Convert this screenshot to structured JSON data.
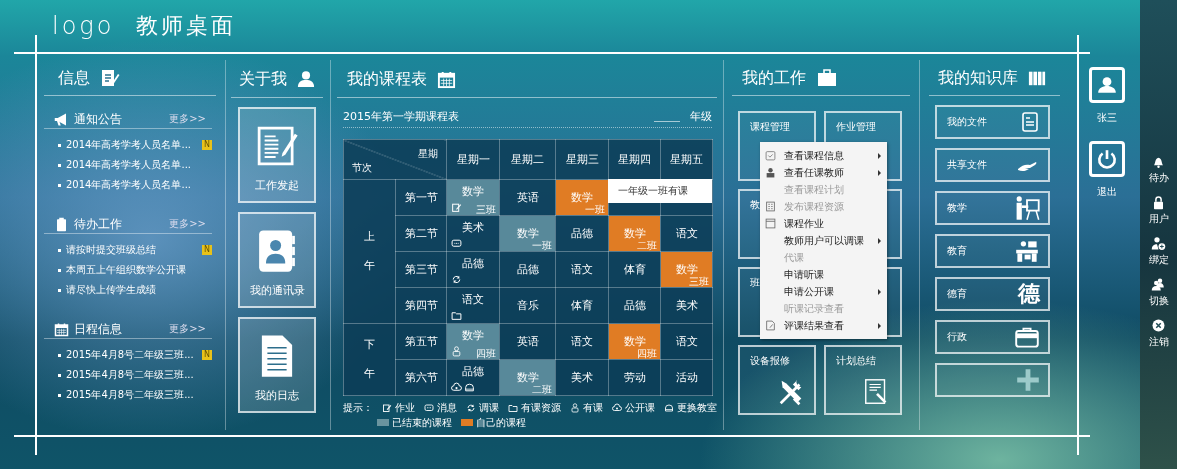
{
  "header": {
    "logo": "logo",
    "title": "教师桌面"
  },
  "info": {
    "title": "信息",
    "sections": [
      {
        "title": "通知公告",
        "more": "更多>>",
        "items": [
          {
            "text": "2014年高考学考人员名单...",
            "badge": "N"
          },
          {
            "text": "2014年高考学考人员名单..."
          },
          {
            "text": "2014年高考学考人员名单..."
          }
        ]
      },
      {
        "title": "待办工作",
        "more": "更多>>",
        "items": [
          {
            "text": "请按时提交班级总结",
            "badge": "N"
          },
          {
            "text": "本周五上午组织数学公开课"
          },
          {
            "text": "请尽快上传学生成绩"
          }
        ]
      },
      {
        "title": "日程信息",
        "more": "更多>>",
        "items": [
          {
            "text": "2015年4月8号二年级三班...",
            "badge": "N"
          },
          {
            "text": "2015年4月8号二年级三班..."
          },
          {
            "text": "2015年4月8号二年级三班..."
          }
        ]
      }
    ]
  },
  "about": {
    "title": "关于我",
    "tiles": [
      {
        "label": "工作发起"
      },
      {
        "label": "我的通讯录"
      },
      {
        "label": "我的日志"
      }
    ]
  },
  "schedule": {
    "title": "我的课程表",
    "term": "2015年第一学期课程表",
    "grade_label": "年级",
    "corner_top": "星期",
    "corner_bottom": "节次",
    "days": [
      "星期一",
      "星期二",
      "星期三",
      "星期四",
      "星期五"
    ],
    "blocks": [
      {
        "label": "上午",
        "rows": [
          {
            "period": "第一节",
            "cells": [
              {
                "subject": "数学",
                "class": "三班",
                "kind": "ended",
                "icons": [
                  {
                    "kind": "homework"
                  }
                ]
              },
              {
                "subject": "英语",
                "kind": "normal"
              },
              {
                "subject": "数学",
                "class": "一班",
                "kind": "own"
              },
              {
                "kind": "normal"
              },
              {
                "kind": "normal"
              }
            ]
          },
          {
            "period": "第二节",
            "cells": [
              {
                "subject": "美术",
                "kind": "normal",
                "icons": [
                  {
                    "kind": "message"
                  }
                ]
              },
              {
                "subject": "数学",
                "class": "一班",
                "kind": "ended"
              },
              {
                "subject": "品德",
                "kind": "normal"
              },
              {
                "subject": "数学",
                "class": "二班",
                "kind": "own"
              },
              {
                "subject": "语文",
                "kind": "normal"
              }
            ]
          },
          {
            "period": "第三节",
            "cells": [
              {
                "subject": "品德",
                "kind": "normal",
                "icons": [
                  {
                    "kind": "swap"
                  }
                ]
              },
              {
                "subject": "品德",
                "kind": "normal"
              },
              {
                "subject": "语文",
                "kind": "normal"
              },
              {
                "subject": "体育",
                "kind": "normal"
              },
              {
                "subject": "数学",
                "class": "三班",
                "kind": "own"
              }
            ]
          },
          {
            "period": "第四节",
            "cells": [
              {
                "subject": "语文",
                "kind": "normal",
                "icons": [
                  {
                    "kind": "resource"
                  }
                ]
              },
              {
                "subject": "音乐",
                "kind": "normal"
              },
              {
                "subject": "体育",
                "kind": "normal"
              },
              {
                "subject": "品德",
                "kind": "normal"
              },
              {
                "subject": "美术",
                "kind": "normal"
              }
            ]
          }
        ]
      },
      {
        "label": "下午",
        "rows": [
          {
            "period": "第五节",
            "cells": [
              {
                "subject": "数学",
                "class": "四班",
                "kind": "ended",
                "icons": [
                  {
                    "kind": "lesson"
                  }
                ]
              },
              {
                "subject": "英语",
                "kind": "normal"
              },
              {
                "subject": "语文",
                "kind": "normal"
              },
              {
                "subject": "数学",
                "class": "四班",
                "kind": "own"
              },
              {
                "subject": "语文",
                "kind": "normal"
              }
            ]
          },
          {
            "period": "第六节",
            "cells": [
              {
                "subject": "品德",
                "kind": "normal",
                "icons": [
                  {
                    "kind": "open"
                  },
                  {
                    "kind": "room"
                  }
                ]
              },
              {
                "subject": "数学",
                "class": "二班",
                "kind": "ended"
              },
              {
                "subject": "美术",
                "kind": "normal"
              },
              {
                "subject": "劳动",
                "kind": "normal"
              },
              {
                "subject": "活动",
                "kind": "normal"
              }
            ]
          }
        ]
      }
    ],
    "tooltip": "一年级一班有课",
    "legend": {
      "label": "提示：",
      "icons": [
        {
          "kind": "homework",
          "text": "作业"
        },
        {
          "kind": "message",
          "text": "消息"
        },
        {
          "kind": "swap",
          "text": "调课"
        },
        {
          "kind": "resource",
          "text": "有课资源"
        },
        {
          "kind": "lesson",
          "text": "有课"
        },
        {
          "kind": "open",
          "text": "公开课"
        },
        {
          "kind": "room",
          "text": "更换教室"
        }
      ],
      "swatches": [
        {
          "kind": "ended",
          "text": "已结束的课程"
        },
        {
          "kind": "own",
          "text": "自己的课程"
        }
      ]
    }
  },
  "work": {
    "title": "我的工作",
    "tiles": [
      {
        "kind": "tile",
        "label": "课程管理"
      },
      {
        "kind": "tile",
        "label": "作业管理"
      },
      {
        "kind": "tile",
        "label": "教"
      },
      {
        "kind": "covered"
      },
      {
        "kind": "tile",
        "label": "班"
      },
      {
        "kind": "covered"
      },
      {
        "kind": "tile",
        "label": "设备报修"
      },
      {
        "kind": "tile",
        "label": "计划总结"
      }
    ],
    "menu": [
      {
        "label": "查看课程信息",
        "disabled": false,
        "submenu": true
      },
      {
        "label": "查看任课教师",
        "disabled": false,
        "submenu": true
      },
      {
        "label": "查看课程计划",
        "disabled": true,
        "submenu": false
      },
      {
        "label": "发布课程资源",
        "disabled": true,
        "submenu": false
      },
      {
        "label": "课程作业",
        "disabled": false,
        "submenu": false
      },
      {
        "label": "教师用户可以调课",
        "disabled": false,
        "submenu": true
      },
      {
        "label": "代课",
        "disabled": true,
        "submenu": false
      },
      {
        "label": "申请听课",
        "disabled": false,
        "submenu": false
      },
      {
        "label": "申请公开课",
        "disabled": false,
        "submenu": true
      },
      {
        "label": "听课记录查看",
        "disabled": true,
        "submenu": false
      },
      {
        "label": "评课结果查看",
        "disabled": false,
        "submenu": true
      }
    ]
  },
  "knowledge": {
    "title": "我的知识库",
    "items": [
      {
        "kind": "link",
        "label": "我的文件"
      },
      {
        "kind": "link",
        "label": "共享文件"
      },
      {
        "kind": "link",
        "label": "教学"
      },
      {
        "kind": "link",
        "label": "教育"
      },
      {
        "kind": "link",
        "label": "德育",
        "glyph": "德"
      },
      {
        "kind": "link",
        "label": "行政"
      },
      {
        "kind": "add"
      }
    ]
  },
  "user": {
    "name": "张三",
    "logout": "退出"
  },
  "side": [
    {
      "label": "待办"
    },
    {
      "label": "用户"
    },
    {
      "label": "绑定"
    },
    {
      "label": "切换"
    },
    {
      "label": "注销"
    }
  ]
}
